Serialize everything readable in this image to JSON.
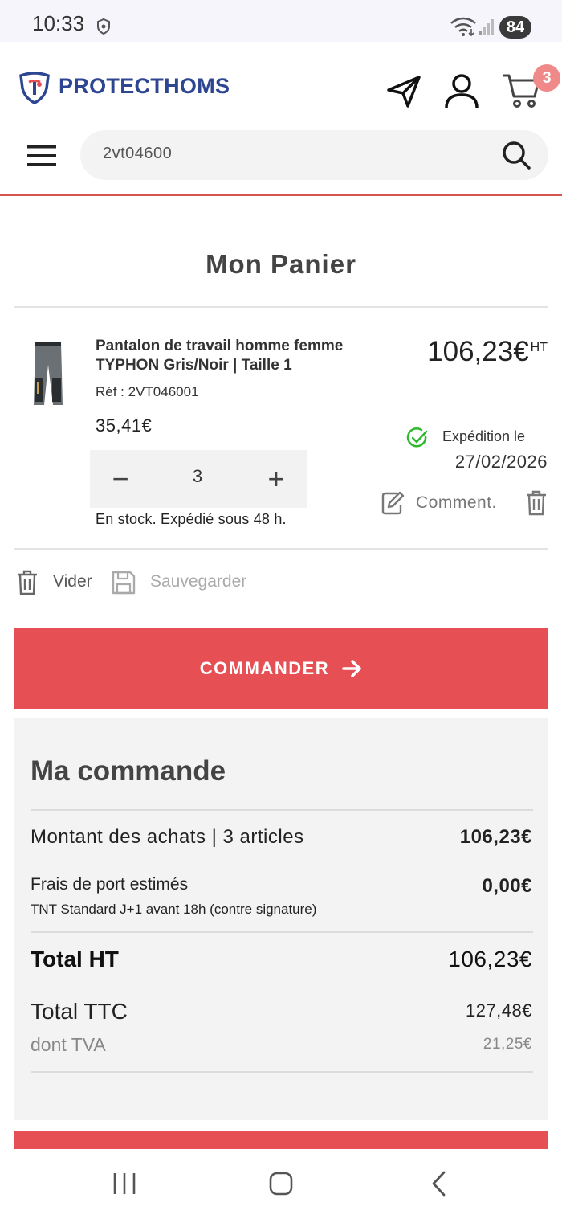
{
  "status_bar": {
    "time": "10:33",
    "battery": "84"
  },
  "header": {
    "logo_text": "PROTECTHOMS",
    "cart_count": "3"
  },
  "search": {
    "value": "2vt04600"
  },
  "cart": {
    "title": "Mon Panier",
    "item": {
      "name": "Pantalon de travail homme femme TYPHON Gris/Noir | Taille 1",
      "ref": "Réf : 2VT046001",
      "unit_price": "35,41€",
      "quantity": "3",
      "stock": "En stock. Expédié sous 48 h.",
      "total": "106,23€",
      "total_suffix": "HT",
      "shipping_label": "Expédition le",
      "shipping_date": "27/02/2026",
      "comment_label": "Comment."
    },
    "actions": {
      "clear_label": "Vider",
      "save_label": "Sauvegarder"
    },
    "order_button": "COMMANDER"
  },
  "summary": {
    "title": "Ma commande",
    "purchases_label": "Montant des achats | 3 articles",
    "purchases_value": "106,23€",
    "shipping_label": "Frais de port estimés",
    "shipping_sub": "TNT Standard J+1 avant 18h (contre signature)",
    "shipping_value": "0,00€",
    "total_ht_label": "Total HT",
    "total_ht_value": "106,23€",
    "total_ttc_label": "Total TTC",
    "total_ttc_value": "127,48€",
    "tva_label": "dont TVA",
    "tva_value": "21,25€"
  },
  "colors": {
    "brand_blue": "#2e4591",
    "accent_red": "#e65054",
    "success_green": "#2eb82e"
  }
}
